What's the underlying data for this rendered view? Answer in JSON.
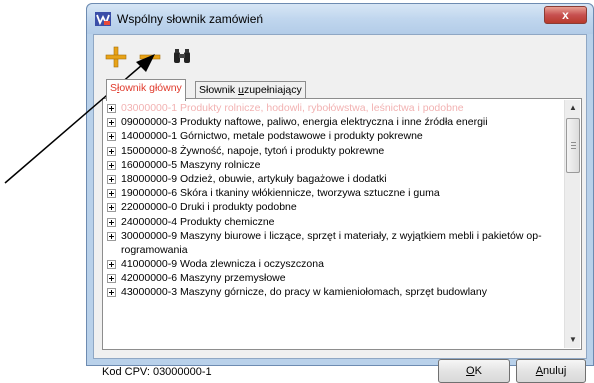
{
  "window": {
    "title": "Wspólny słownik zamówień",
    "close_label": "x"
  },
  "toolbar": {
    "add_icon": "plus-icon",
    "remove_icon": "minus-icon",
    "find_icon": "binoculars-icon"
  },
  "tabs": [
    {
      "pre": "S",
      "underline": "ł",
      "post": "ownik główny",
      "active": true
    },
    {
      "pre": "Słownik ",
      "underline": "u",
      "post": "zupełniający",
      "active": false
    }
  ],
  "tree": {
    "rows": [
      {
        "code": "03000000-1",
        "label": "Produkty rolnicze, hodowli, rybołówstwa, leśnictwa i podobne",
        "selected": true
      },
      {
        "code": "09000000-3",
        "label": "Produkty naftowe, paliwo, energia elektryczna i inne źródła energii"
      },
      {
        "code": "14000000-1",
        "label": "Górnictwo, metale podstawowe i produkty pokrewne"
      },
      {
        "code": "15000000-8",
        "label": "Żywność, napoje, tytoń i produkty pokrewne"
      },
      {
        "code": "16000000-5",
        "label": "Maszyny rolnicze"
      },
      {
        "code": "18000000-9",
        "label": "Odzież, obuwie, artykuły bagażowe i dodatki"
      },
      {
        "code": "19000000-6",
        "label": "Skóra i tkaniny włókiennicze, tworzywa sztuczne i guma"
      },
      {
        "code": "22000000-0",
        "label": "Druki i produkty podobne"
      },
      {
        "code": "24000000-4",
        "label": "Produkty chemiczne"
      },
      {
        "code": "30000000-9",
        "label": "Maszyny biurowe i liczące, sprzęt i materiały, z wyjątkiem mebli i pakietów op-"
      },
      {
        "code": "",
        "label": "rogramowania",
        "continuation": true
      },
      {
        "code": "41000000-9",
        "label": "Woda zlewnicza i oczyszczona"
      },
      {
        "code": "42000000-6",
        "label": "Maszyny przemysłowe"
      },
      {
        "code": "43000000-3",
        "label": "Maszyny górnicze, do pracy w kamieniołomach, sprzęt budowlany"
      }
    ]
  },
  "status": {
    "cpv_text": "Kod CPV: 03000000-1"
  },
  "buttons": {
    "ok": {
      "underline": "O",
      "post": "K"
    },
    "cancel": {
      "underline": "A",
      "post": "nuluj"
    }
  },
  "colors": {
    "title_bar": "#c0d6ee",
    "close_button": "#c75050",
    "active_tab_text": "#e03a2c",
    "add_icon": "#e8a317",
    "selected_text": "#f2b2b2"
  }
}
